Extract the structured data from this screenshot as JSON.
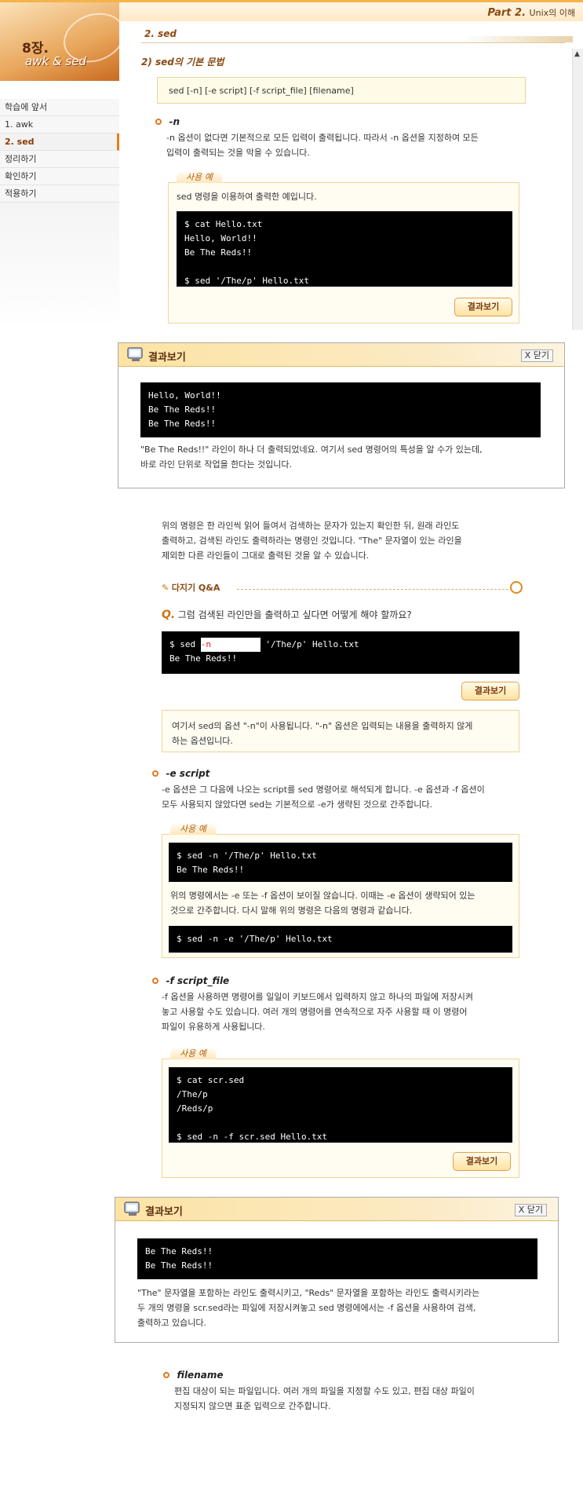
{
  "header": {
    "part_label": "Part 2.",
    "part_title": "Unix의 이해"
  },
  "logo": {
    "chapter": "8장.",
    "name": "awk & sed"
  },
  "sidebar": {
    "items": [
      {
        "label": "학습에 앞서"
      },
      {
        "label": "1. awk"
      },
      {
        "label": "2. sed"
      },
      {
        "label": "정리하기"
      },
      {
        "label": "확인하기"
      },
      {
        "label": "적용하기"
      }
    ]
  },
  "section": {
    "title": "2. sed",
    "subtitle": "2) sed의 기본 문법"
  },
  "syntax": {
    "text": "sed [-n] [-e script] [-f script_file] [filename]"
  },
  "opt_n": {
    "title": "-n",
    "desc1": "-n 옵션이 없다면 기본적으로 모든 입력이 출력됩니다. 따라서 -n 옵션을 지정하여 모든",
    "desc2": "입력이 출력되는 것을 막을 수 있습니다.",
    "example_label": "사용 예",
    "example_intro": "sed 명령을 이용하여 출력한 예입니다.",
    "terminal": [
      "$ cat Hello.txt",
      "Hello, World!!",
      "Be The Reds!!",
      "",
      "$ sed '/The/p' Hello.txt"
    ],
    "result_button": "결과보기"
  },
  "popup1": {
    "title": "결과보기",
    "close_label": "X 닫기",
    "terminal": [
      "Hello, World!!",
      "Be The Reds!!",
      "Be The Reds!!"
    ],
    "desc1": "\"Be The Reds!!\" 라인이 하나 더 출력되었네요. 여기서 sed 명령어의 특성을 알 수가 있는데,",
    "desc2": "바로 라인 단위로 작업을 한다는 것입니다."
  },
  "explain": {
    "line1": "위의 명령은 한 라인씩 읽어 들여서 검색하는 문자가 있는지 확인한 뒤, 원래 라인도",
    "line2": "출력하고, 검색된 라인도 출력하라는 명령인 것입니다. \"The\" 문자열이 있는 라인을",
    "line3": "제외한 다른 라인들이 그대로 출력된 것을 알 수 있습니다."
  },
  "qa": {
    "label": "다지기 Q&A",
    "question": "그럼 검색된 라인만을 출력하고 싶다면 어떻게 해야 할까요?",
    "term_prefix": "$ sed ",
    "term_input": "-n",
    "term_suffix": " '/The/p' Hello.txt",
    "term_line2": "Be The Reds!!",
    "result_button": "결과보기",
    "answer1": "여기서 sed의 옵션 \"-n\"이 사용됩니다. \"-n\" 옵션은 입력되는 내용을 출력하지 않게",
    "answer2": "하는 옵션입니다."
  },
  "opt_e": {
    "title": "-e script",
    "desc1": "-e 옵션은 그 다음에 나오는 script를 sed 명령어로 해석되게 합니다. -e 옵션과 -f 옵션이",
    "desc2": "모두 사용되지 않았다면 sed는 기본적으로 -e가 생략된 것으로 간주합니다.",
    "example_label": "사용 예",
    "terminal1": [
      "$ sed -n '/The/p' Hello.txt",
      "Be The Reds!!"
    ],
    "mid1": "위의 명령에서는 -e 또는 -f 옵션이 보이질 않습니다. 이때는 -e 옵션이 생략되어 있는",
    "mid2": "것으로 간주합니다. 다시 말해 위의 명령은 다음의 명령과 같습니다.",
    "terminal2": [
      "$ sed -n -e '/The/p' Hello.txt"
    ]
  },
  "opt_f": {
    "title": "-f script_file",
    "desc1": "-f 옵션을 사용하면 명령어를 일일이 키보드에서 입력하지 않고 하나의 파일에 저장시켜",
    "desc2": "놓고 사용할 수도 있습니다. 여러 개의 명령어를 연속적으로 자주 사용할 때 이 명령어",
    "desc3": "파일이 유용하게 사용됩니다.",
    "example_label": "사용 예",
    "terminal": [
      "$ cat scr.sed",
      "/The/p",
      "/Reds/p",
      "",
      "$ sed -n -f scr.sed Hello.txt"
    ],
    "result_button": "결과보기"
  },
  "popup2": {
    "title": "결과보기",
    "close_label": "X 닫기",
    "terminal": [
      "Be The Reds!!",
      "Be The Reds!!"
    ],
    "desc1": "\"The\" 문자열을 포함하는 라인도 출력시키고, \"Reds\" 문자열을 포함하는 라인도 출력시키라는",
    "desc2": "두 개의 명령을 scr.sed라는 파일에 저장시켜놓고 sed 명령에에서는 -f 옵션을 사용하여 검색,",
    "desc3": "출력하고 있습니다."
  },
  "opt_filename": {
    "title": "filename",
    "desc1": "편집 대상이 되는 파일입니다. 여러 개의 파일을 지정할 수도 있고, 편집 대상 파일이",
    "desc2": "지정되지 않으면 표준 입력으로 간주합니다."
  }
}
